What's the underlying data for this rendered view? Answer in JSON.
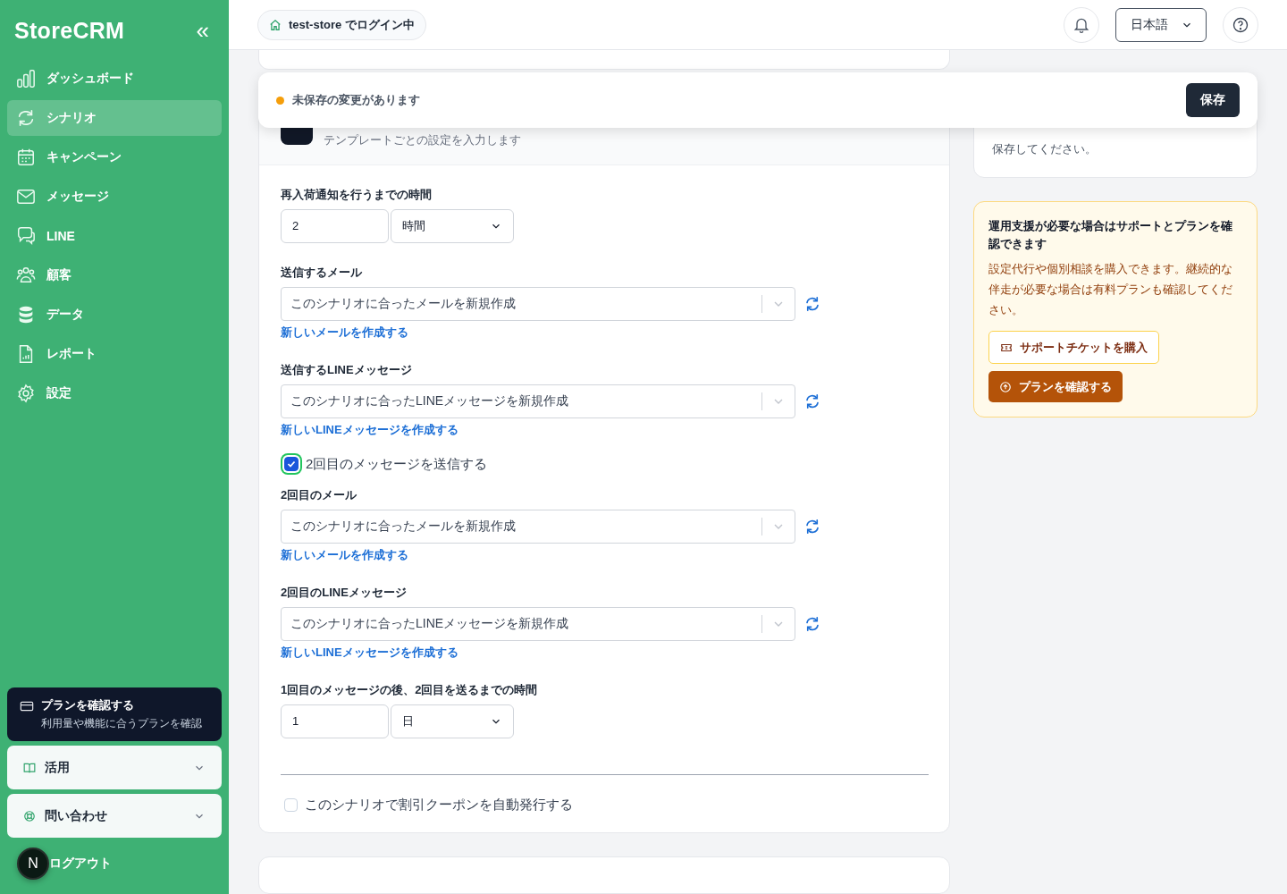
{
  "sidebar": {
    "logo": "StoreCRM",
    "collapse_icon": "«",
    "items": [
      {
        "label": "ダッシュボード",
        "kind": "chart",
        "selected": false
      },
      {
        "label": "シナリオ",
        "kind": "sync",
        "selected": true
      },
      {
        "label": "キャンペーン",
        "kind": "calendar",
        "selected": false
      },
      {
        "label": "メッセージ",
        "kind": "mail",
        "selected": false
      },
      {
        "label": "LINE",
        "kind": "chat",
        "selected": false
      },
      {
        "label": "顧客",
        "kind": "users",
        "selected": false
      },
      {
        "label": "データ",
        "kind": "database",
        "selected": false
      },
      {
        "label": "レポート",
        "kind": "report",
        "selected": false
      },
      {
        "label": "設定",
        "kind": "gear",
        "selected": false
      }
    ],
    "plan_card": {
      "title": "プランを確認する",
      "subtitle": "利用量や機能に合うプランを確認"
    },
    "accordions": [
      {
        "label": "活用",
        "kind": "book",
        "expanded": false
      },
      {
        "label": "問い合わせ",
        "kind": "lifebuoy",
        "expanded": false
      }
    ],
    "avatar": "N",
    "logout": "ログアウト"
  },
  "header": {
    "login_badge": "test-store でログイン中",
    "language": "日本語"
  },
  "unsaved_bar": {
    "message": "未保存の変更があります",
    "save_button": "保存"
  },
  "section": {
    "subtitle": "テンプレートごとの設定を入力します",
    "fields": [
      {
        "kind": "duration",
        "label": "再入荷通知を行うまでの時間",
        "value": "2",
        "unit": "時間"
      },
      {
        "kind": "select",
        "label": "送信するメール",
        "value": "このシナリオに合ったメールを新規作成",
        "link": "新しいメールを作成する"
      },
      {
        "kind": "select",
        "label": "送信するLINEメッセージ",
        "value": "このシナリオに合ったLINEメッセージを新規作成",
        "link": "新しいLINEメッセージを作成する"
      },
      {
        "kind": "checkbox",
        "label": "2回目のメッセージを送信する",
        "checked": true
      },
      {
        "kind": "select",
        "label": "2回目のメール",
        "value": "このシナリオに合ったメールを新規作成",
        "link": "新しいメールを作成する"
      },
      {
        "kind": "select",
        "label": "2回目のLINEメッセージ",
        "value": "このシナリオに合ったLINEメッセージを新規作成",
        "link": "新しいLINEメッセージを作成する"
      },
      {
        "kind": "duration",
        "label": "1回目のメッセージの後、2回目を送るまでの時間",
        "value": "1",
        "unit": "日"
      }
    ],
    "coupon": {
      "label": "このシナリオで割引クーポンを自動発行する",
      "checked": false
    }
  },
  "right_cards": {
    "note": "保存してください。",
    "support": {
      "title": "運用支援が必要な場合はサポートとプランを確認できます",
      "body": "設定代行や個別相談を購入できます。継続的な伴走が必要な場合は有料プランも確認してください。",
      "ticket_button": "サポートチケットを購入",
      "plan_button": "プランを確認する"
    }
  }
}
